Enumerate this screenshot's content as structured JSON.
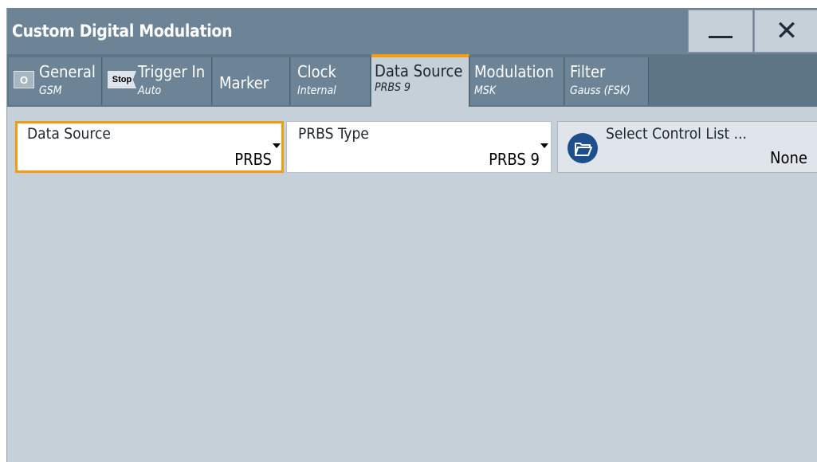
{
  "window": {
    "title": "Custom Digital Modulation",
    "minimize_icon": "minimize-icon",
    "close_icon": "close-icon"
  },
  "tabs": [
    {
      "label": "General",
      "sub": "GSM",
      "badge": "O"
    },
    {
      "label": "Trigger In",
      "sub": "Auto",
      "badge": "Stop"
    },
    {
      "label": "Marker",
      "sub": ""
    },
    {
      "label": "Clock",
      "sub": "Internal"
    },
    {
      "label": "Data Source",
      "sub": "PRBS 9",
      "active": true
    },
    {
      "label": "Modulation",
      "sub": "MSK"
    },
    {
      "label": "Filter",
      "sub": "Gauss (FSK)"
    }
  ],
  "fields": {
    "data_source": {
      "label": "Data Source",
      "value": "PRBS"
    },
    "prbs_type": {
      "label": "PRBS Type",
      "value": "PRBS 9"
    },
    "control_list": {
      "label": "Select Control List ...",
      "value": "None",
      "icon": "folder-open-icon"
    }
  },
  "colors": {
    "accent": "#f39c12",
    "titlebar": "#6c8496",
    "panel": "#c5d0d8",
    "icon_blue": "#1d4f8c"
  }
}
